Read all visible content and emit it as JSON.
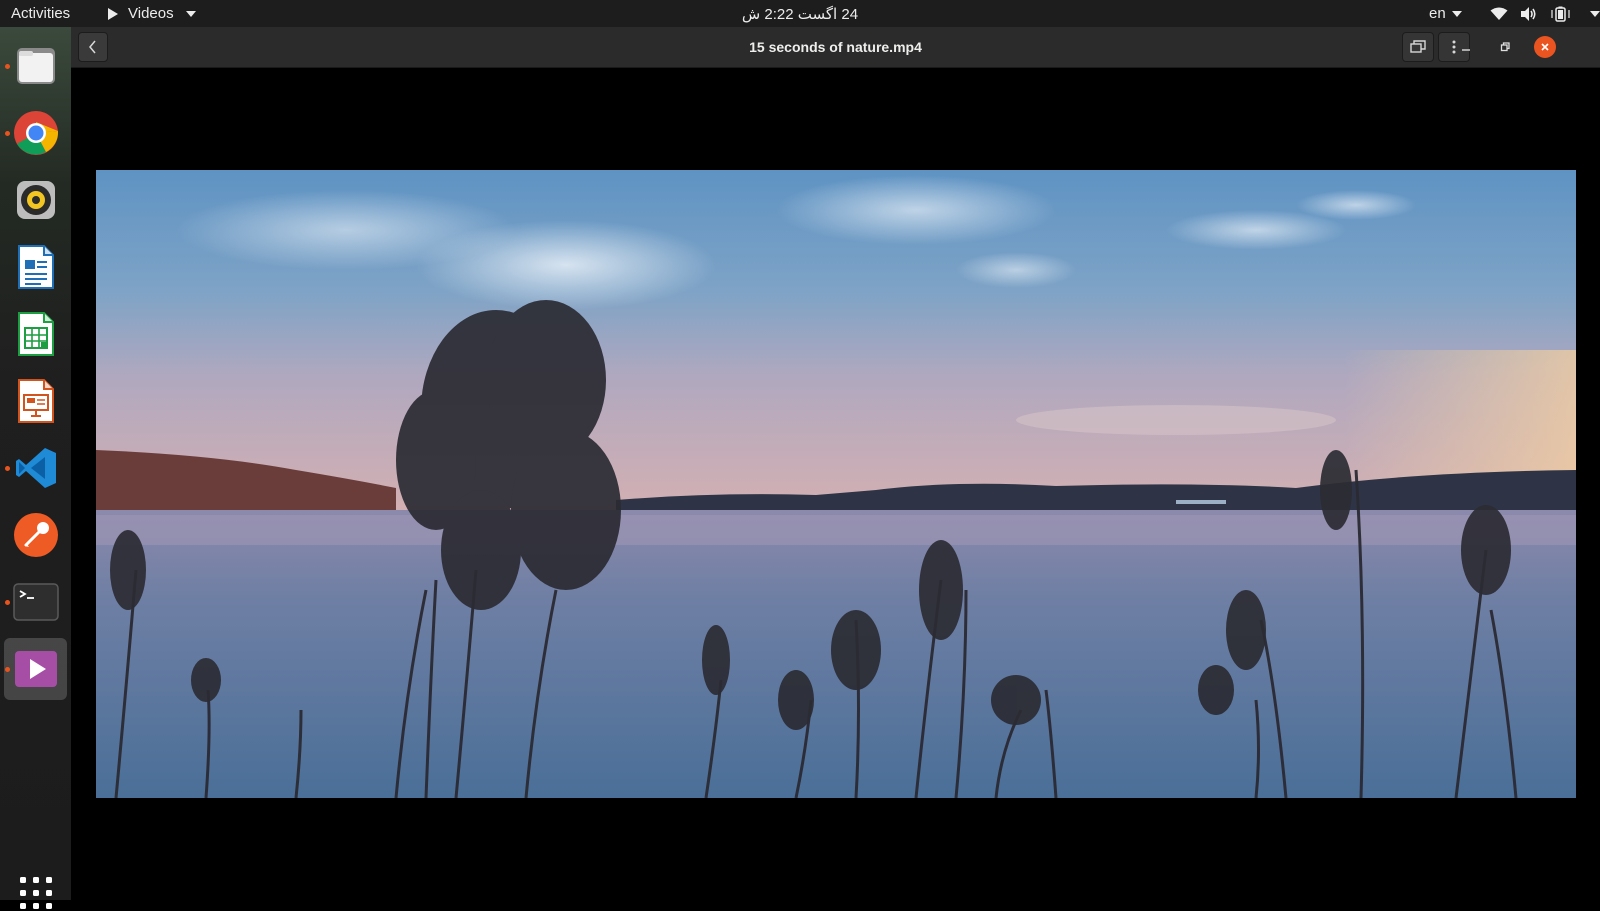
{
  "topbar": {
    "activities_label": "Activities",
    "app_menu_label": "Videos",
    "clock_text": "24 اگست  2:22 ش",
    "language": "en"
  },
  "dock": {
    "items": [
      {
        "name": "files",
        "icon": "folder-icon",
        "running": true,
        "active": false
      },
      {
        "name": "chrome",
        "icon": "chrome-icon",
        "running": true,
        "active": false
      },
      {
        "name": "rhythmbox",
        "icon": "speaker-icon",
        "running": false,
        "active": false
      },
      {
        "name": "writer",
        "icon": "writer-document-icon",
        "running": false,
        "active": false
      },
      {
        "name": "calc",
        "icon": "calc-spreadsheet-icon",
        "running": false,
        "active": false
      },
      {
        "name": "impress",
        "icon": "impress-presentation-icon",
        "running": false,
        "active": false
      },
      {
        "name": "vscode",
        "icon": "vscode-icon",
        "running": true,
        "active": false
      },
      {
        "name": "postman",
        "icon": "postman-icon",
        "running": false,
        "active": false
      },
      {
        "name": "terminal",
        "icon": "terminal-icon",
        "running": true,
        "active": false
      },
      {
        "name": "videos",
        "icon": "video-player-icon",
        "running": true,
        "active": true
      }
    ],
    "show_apps_icon": "grid-icon"
  },
  "window": {
    "title": "15 seconds of nature.mp4"
  },
  "colors": {
    "accent": "#e95420",
    "topbar_bg": "#1d1d1d",
    "headerbar_bg": "#2b2b2b",
    "running_dot": "#e9541e"
  }
}
